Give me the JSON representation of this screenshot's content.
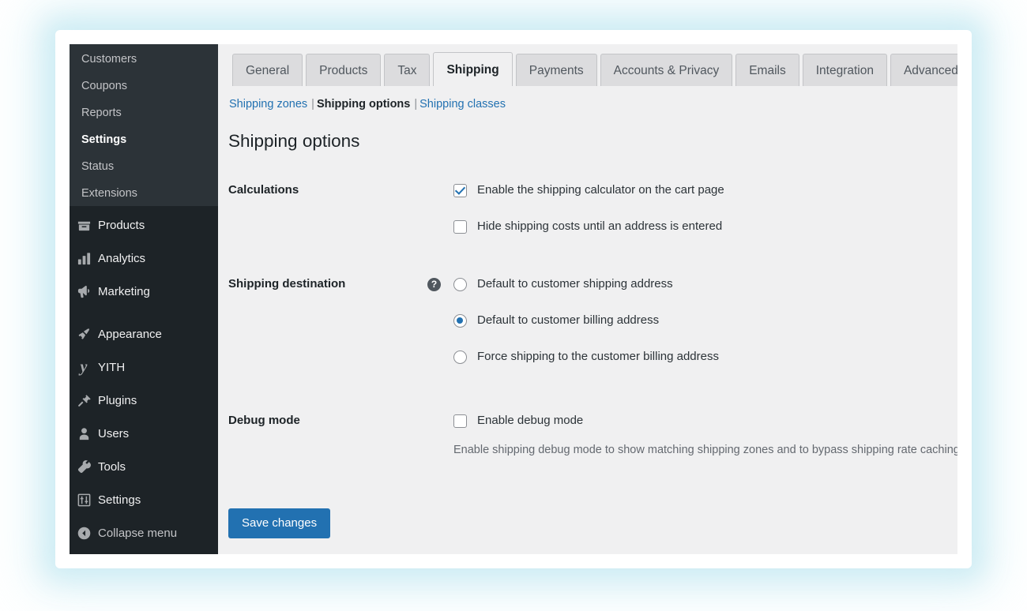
{
  "sidebar": {
    "submenu_items": [
      {
        "label": "Customers",
        "current": false
      },
      {
        "label": "Coupons",
        "current": false
      },
      {
        "label": "Reports",
        "current": false
      },
      {
        "label": "Settings",
        "current": true
      },
      {
        "label": "Status",
        "current": false
      },
      {
        "label": "Extensions",
        "current": false
      }
    ],
    "menu_items": [
      {
        "label": "Products",
        "icon": "products-icon"
      },
      {
        "label": "Analytics",
        "icon": "analytics-icon"
      },
      {
        "label": "Marketing",
        "icon": "marketing-icon"
      },
      {
        "label": "Appearance",
        "icon": "appearance-icon"
      },
      {
        "label": "YITH",
        "icon": "yith-icon"
      },
      {
        "label": "Plugins",
        "icon": "plugins-icon"
      },
      {
        "label": "Users",
        "icon": "users-icon"
      },
      {
        "label": "Tools",
        "icon": "tools-icon"
      },
      {
        "label": "Settings",
        "icon": "settings-icon"
      },
      {
        "label": "Collapse menu",
        "icon": "collapse-icon"
      }
    ]
  },
  "tabs": [
    {
      "label": "General",
      "active": false
    },
    {
      "label": "Products",
      "active": false
    },
    {
      "label": "Tax",
      "active": false
    },
    {
      "label": "Shipping",
      "active": true
    },
    {
      "label": "Payments",
      "active": false
    },
    {
      "label": "Accounts & Privacy",
      "active": false
    },
    {
      "label": "Emails",
      "active": false
    },
    {
      "label": "Integration",
      "active": false
    },
    {
      "label": "Advanced",
      "active": false
    }
  ],
  "subnav": {
    "zones": "Shipping zones",
    "options": "Shipping options",
    "classes": "Shipping classes",
    "separator": "|"
  },
  "page_title": "Shipping options",
  "sections": {
    "calculations": {
      "label": "Calculations",
      "options": [
        {
          "label": "Enable the shipping calculator on the cart page",
          "checked": true
        },
        {
          "label": "Hide shipping costs until an address is entered",
          "checked": false
        }
      ]
    },
    "shipping_destination": {
      "label": "Shipping destination",
      "help_glyph": "?",
      "options": [
        {
          "label": "Default to customer shipping address",
          "selected": false
        },
        {
          "label": "Default to customer billing address",
          "selected": true
        },
        {
          "label": "Force shipping to the customer billing address",
          "selected": false
        }
      ]
    },
    "debug_mode": {
      "label": "Debug mode",
      "option": {
        "label": "Enable debug mode",
        "checked": false
      },
      "description": "Enable shipping debug mode to show matching shipping zones and to bypass shipping rate caching."
    }
  },
  "save_button": "Save changes",
  "colors": {
    "accent": "#2271b1",
    "sidebar_bg": "#1d2327",
    "submenu_bg": "#2c3338",
    "content_bg": "#f0f0f1"
  }
}
